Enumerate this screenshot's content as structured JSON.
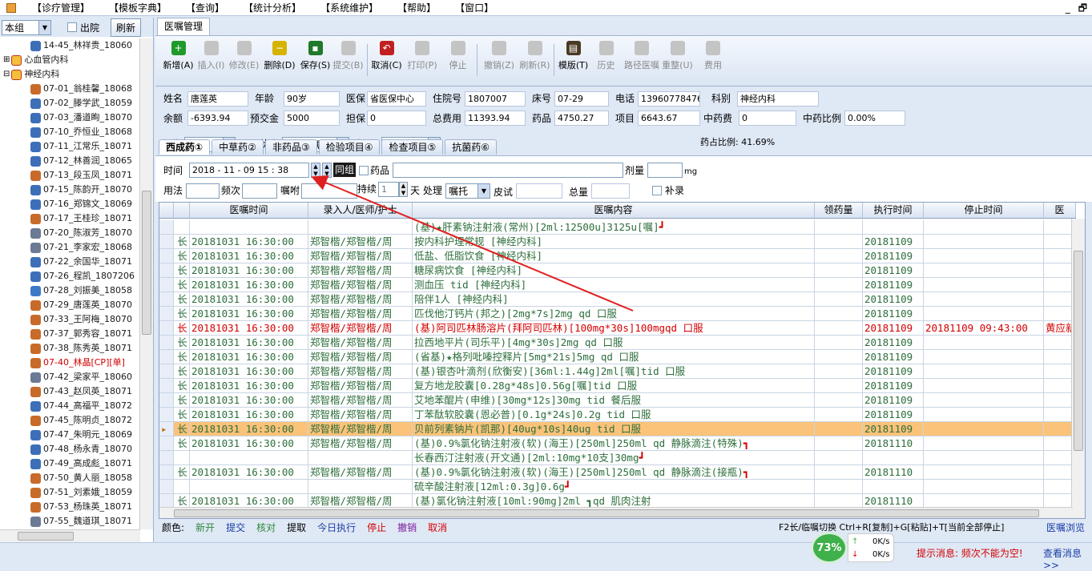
{
  "menu": [
    "【诊疗管理】",
    "【模板字典】",
    "【查询】",
    "【统计分析】",
    "【系统维护】",
    "【帮助】",
    "【窗口】"
  ],
  "window_buttons": [
    "_",
    "🗗"
  ],
  "left": {
    "group_select": "本组",
    "discharge_label": "出院",
    "refresh_label": "刷新",
    "tree": [
      {
        "label": "14-45_林祥贵_18060",
        "indent": 2,
        "icon": "person-icon",
        "color": "#1a1a1a"
      },
      {
        "label": "心血管内科",
        "indent": 0,
        "icon": "dept-icon",
        "color": "#1a1a1a",
        "expander": "+"
      },
      {
        "label": "神经内科",
        "indent": 0,
        "icon": "dept-icon",
        "color": "#1a1a1a",
        "expander": "-"
      },
      {
        "label": "07-01_翁桂馨_18068",
        "indent": 2,
        "icon": "person-f-icon",
        "color": "#1a1a1a"
      },
      {
        "label": "07-02_滕学武_18059",
        "indent": 2,
        "icon": "person-icon",
        "color": "#1a1a1a"
      },
      {
        "label": "07-03_潘道眴_18070",
        "indent": 2,
        "icon": "person-icon",
        "color": "#1a1a1a"
      },
      {
        "label": "07-10_乔恒业_18068",
        "indent": 2,
        "icon": "person-icon",
        "color": "#1a1a1a"
      },
      {
        "label": "07-11_江常乐_18071",
        "indent": 2,
        "icon": "person-icon",
        "color": "#1a1a1a"
      },
      {
        "label": "07-12_林善润_18065",
        "indent": 2,
        "icon": "person-icon",
        "color": "#1a1a1a"
      },
      {
        "label": "07-13_段玉凤_18071",
        "indent": 2,
        "icon": "person-f-icon",
        "color": "#1a1a1a"
      },
      {
        "label": "07-15_陈韵开_18070",
        "indent": 2,
        "icon": "person-icon",
        "color": "#1a1a1a"
      },
      {
        "label": "07-16_郑锦文_18069",
        "indent": 2,
        "icon": "person-icon",
        "color": "#1a1a1a"
      },
      {
        "label": "07-17_王桂珍_18071",
        "indent": 2,
        "icon": "person-f-icon",
        "color": "#1a1a1a"
      },
      {
        "label": "07-20_陈淑芳_18070",
        "indent": 2,
        "icon": "printer-icon",
        "color": "#1a1a1a"
      },
      {
        "label": "07-21_李家宏_18068",
        "indent": 2,
        "icon": "printer-icon",
        "color": "#1a1a1a"
      },
      {
        "label": "07-22_余国华_18071",
        "indent": 2,
        "icon": "person-icon",
        "color": "#1a1a1a"
      },
      {
        "label": "07-26_程凯_1807206",
        "indent": 2,
        "icon": "person-icon",
        "color": "#1a1a1a"
      },
      {
        "label": "07-28_刘振美_18058",
        "indent": 2,
        "icon": "check-icon",
        "color": "#1a1a1a"
      },
      {
        "label": "07-29_唐莲英_18070",
        "indent": 2,
        "icon": "person-f-icon",
        "color": "#1a1a1a"
      },
      {
        "label": "07-33_王阿梅_18070",
        "indent": 2,
        "icon": "person-f-icon",
        "color": "#1a1a1a"
      },
      {
        "label": "07-37_郭秀容_18071",
        "indent": 2,
        "icon": "person-f-icon",
        "color": "#1a1a1a"
      },
      {
        "label": "07-38_陈秀英_18071",
        "indent": 2,
        "icon": "person-f-icon",
        "color": "#1a1a1a"
      },
      {
        "label": "07-40_林晶[CP][单]",
        "indent": 2,
        "icon": "person-f-icon",
        "color": "#d40000"
      },
      {
        "label": "07-42_梁家平_18060",
        "indent": 2,
        "icon": "printer-icon",
        "color": "#1a1a1a"
      },
      {
        "label": "07-43_赵凤英_18071",
        "indent": 2,
        "icon": "person-f-icon",
        "color": "#1a1a1a"
      },
      {
        "label": "07-44_高福平_18072",
        "indent": 2,
        "icon": "person-icon",
        "color": "#1a1a1a"
      },
      {
        "label": "07-45_陈明贞_18072",
        "indent": 2,
        "icon": "person-f-icon",
        "color": "#1a1a1a"
      },
      {
        "label": "07-47_朱明元_18069",
        "indent": 2,
        "icon": "person-icon",
        "color": "#1a1a1a"
      },
      {
        "label": "07-48_杨永青_18070",
        "indent": 2,
        "icon": "person-icon",
        "color": "#1a1a1a"
      },
      {
        "label": "07-49_高成彪_18071",
        "indent": 2,
        "icon": "person-icon",
        "color": "#1a1a1a"
      },
      {
        "label": "07-50_黄人丽_18058",
        "indent": 2,
        "icon": "person-f-icon",
        "color": "#1a1a1a"
      },
      {
        "label": "07-51_刘素娥_18059",
        "indent": 2,
        "icon": "person-f-icon",
        "color": "#1a1a1a"
      },
      {
        "label": "07-53_杨珠英_18071",
        "indent": 2,
        "icon": "person-f-icon",
        "color": "#1a1a1a"
      },
      {
        "label": "07-55_魏道琪_18071",
        "indent": 2,
        "icon": "printer-icon",
        "color": "#1a1a1a"
      },
      {
        "label": "07-56_黄祖圣_18068",
        "indent": 2,
        "icon": "person-icon",
        "color": "#1a1a1a"
      },
      {
        "label": "07-59_王丽英_18071",
        "indent": 2,
        "icon": "person-f-icon",
        "color": "#1a1a1a"
      },
      {
        "label": "神内测试_测试专用",
        "indent": 2,
        "icon": "printer-icon",
        "color": "#1a1a1a"
      }
    ]
  },
  "main_tab": "医嘱管理",
  "toolbar": [
    {
      "label": "新增(A)",
      "icon": "add-icon",
      "enabled": true,
      "color": "#1f9a2a",
      "glyph": "+"
    },
    {
      "label": "插入(I)",
      "icon": "insert-icon",
      "enabled": false,
      "color": "#c4c4c4",
      "glyph": ""
    },
    {
      "label": "修改(E)",
      "icon": "edit-icon",
      "enabled": false,
      "color": "#c4c4c4",
      "glyph": ""
    },
    {
      "label": "删除(D)",
      "icon": "delete-icon",
      "enabled": true,
      "color": "#d4b400",
      "glyph": "−",
      "dropdown": true
    },
    {
      "label": "保存(S)",
      "icon": "save-icon",
      "enabled": true,
      "color": "#1f7a2a",
      "glyph": "▪"
    },
    {
      "label": "提交(B)",
      "icon": "submit-icon",
      "enabled": false,
      "color": "#c4c4c4",
      "glyph": ""
    },
    {
      "label": "取消(C)",
      "icon": "undo-icon",
      "enabled": true,
      "color": "#c02020",
      "glyph": "↶"
    },
    {
      "label": "打印(P)",
      "icon": "print-icon",
      "enabled": false,
      "color": "#c4c4c4",
      "glyph": "",
      "dropdown": true
    },
    {
      "label": "停止",
      "icon": "stop-icon",
      "enabled": false,
      "color": "#c4c4c4",
      "glyph": ""
    },
    {
      "label": "撤销(Z)",
      "icon": "trash-icon",
      "enabled": false,
      "color": "#c4c4c4",
      "glyph": "",
      "dropdown": true
    },
    {
      "label": "刷新(R)",
      "icon": "refresh-icon",
      "enabled": false,
      "color": "#c4c4c4",
      "glyph": ""
    },
    {
      "label": "模版(T)",
      "icon": "template-icon",
      "enabled": true,
      "color": "#4a3a24",
      "glyph": "▤"
    },
    {
      "label": "历史",
      "icon": "history-icon",
      "enabled": false,
      "color": "#c4c4c4",
      "glyph": ""
    },
    {
      "label": "路径医嘱",
      "icon": "path-icon",
      "enabled": false,
      "color": "#c4c4c4",
      "glyph": "",
      "dropdown": true
    },
    {
      "label": "重整(U)",
      "icon": "reorganize-icon",
      "enabled": false,
      "color": "#c4c4c4",
      "glyph": ""
    },
    {
      "label": "费用",
      "icon": "fee-icon",
      "enabled": false,
      "color": "#c4c4c4",
      "glyph": "",
      "dropdown": true
    }
  ],
  "patient": {
    "name_label": "姓名",
    "name": "唐莲英",
    "age_label": "年龄",
    "age": "90岁",
    "insurance_label": "医保",
    "insurance": "省医保中心",
    "admission_label": "住院号",
    "admission": "1807007",
    "bed_label": "床号",
    "bed": "07-29",
    "phone_label": "电话",
    "phone": "13960778476",
    "dept_label": "科别",
    "dept": "神经内科",
    "balance_label": "余额",
    "balance": "-6393.94",
    "deposit_label": "预交金",
    "deposit": "5000",
    "guarantee_label": "担保",
    "guarantee": "0",
    "total_label": "总费用",
    "total": "11393.94",
    "drug_label": "药品",
    "drug": "4750.27",
    "item_label": "项目",
    "item": "6643.67",
    "herb_label": "中药费",
    "herb": "0",
    "herb_ratio_label": "中药比例",
    "herb_ratio": "0.00%"
  },
  "filters": {
    "longterm_label": "长临",
    "longterm": "长嘱",
    "status_label": "医嘱状态",
    "status": "今日医嘱",
    "category_label": "类别",
    "category": "全部",
    "drug_ratio": "药占比例: 41.69%"
  },
  "subtabs": [
    "西成药①",
    "中草药②",
    "非药品③",
    "检验项目④",
    "检查项目⑤",
    "抗菌药⑥"
  ],
  "form": {
    "time_label": "时间",
    "time": "2018 - 11 - 09   15 : 38",
    "group_label": "同组",
    "drug_label": "药品",
    "dose_label": "剂量",
    "dose_unit": "mg",
    "usage_label": "用法",
    "freq_label": "频次",
    "note_label": "嘱咐",
    "duration_label": "持续",
    "duration": "1",
    "day_label": "天",
    "process_label": "处理",
    "process": "嘱托",
    "skin_label": "皮试",
    "total_label": "总量",
    "supplement_label": "补录"
  },
  "grid": {
    "headers": [
      "",
      "",
      "医嘱时间",
      "录入人/医师/护士",
      "医嘱内容",
      "领药量",
      "执行时间",
      "停止时间",
      "医"
    ],
    "rows": [
      {
        "type": "",
        "time": "",
        "user": "",
        "content": "(基)★肝素钠注射液(常州)[2ml:12500u]3125u[嘱]",
        "exec": "",
        "stop": "",
        "extra": "",
        "style": "normal",
        "bracket": "┛"
      },
      {
        "type": "长",
        "time": "20181031 16:30:00",
        "user": "郑智楷/郑智楷/周",
        "content": "按内科护理常规   [神经内科]",
        "exec": "20181109",
        "stop": "",
        "extra": "",
        "style": "normal"
      },
      {
        "type": "长",
        "time": "20181031 16:30:00",
        "user": "郑智楷/郑智楷/周",
        "content": "低盐、低脂饮食   [神经内科]",
        "exec": "20181109",
        "stop": "",
        "extra": "",
        "style": "normal"
      },
      {
        "type": "长",
        "time": "20181031 16:30:00",
        "user": "郑智楷/郑智楷/周",
        "content": "糖尿病饮食    [神经内科]",
        "exec": "20181109",
        "stop": "",
        "extra": "",
        "style": "normal"
      },
      {
        "type": "长",
        "time": "20181031 16:30:00",
        "user": "郑智楷/郑智楷/周",
        "content": "测血压 tid  [神经内科]",
        "exec": "20181109",
        "stop": "",
        "extra": "",
        "style": "normal"
      },
      {
        "type": "长",
        "time": "20181031 16:30:00",
        "user": "郑智楷/郑智楷/周",
        "content": "陪伴1人    [神经内科]",
        "exec": "20181109",
        "stop": "",
        "extra": "",
        "style": "normal"
      },
      {
        "type": "长",
        "time": "20181031 16:30:00",
        "user": "郑智楷/郑智楷/周",
        "content": "匹伐他汀钙片(邦之)[2mg*7s]2mg qd 口服",
        "exec": "20181109",
        "stop": "",
        "extra": "",
        "style": "normal"
      },
      {
        "type": "长",
        "time": "20181031 16:30:00",
        "user": "郑智楷/郑智楷/周",
        "content": "(基)阿司匹林肠溶片(拜阿司匹林)[100mg*30s]100mgqd 口服",
        "exec": "20181109",
        "stop": "20181109 09:43:00",
        "extra": "黄应新",
        "style": "red"
      },
      {
        "type": "长",
        "time": "20181031 16:30:00",
        "user": "郑智楷/郑智楷/周",
        "content": "拉西地平片(司乐平)[4mg*30s]2mg qd 口服",
        "exec": "20181109",
        "stop": "",
        "extra": "",
        "style": "normal"
      },
      {
        "type": "长",
        "time": "20181031 16:30:00",
        "user": "郑智楷/郑智楷/周",
        "content": "(省基)★格列吡嗪控释片[5mg*21s]5mg qd 口服",
        "exec": "20181109",
        "stop": "",
        "extra": "",
        "style": "normal"
      },
      {
        "type": "长",
        "time": "20181031 16:30:00",
        "user": "郑智楷/郑智楷/周",
        "content": "(基)银杏叶滴剂(欣衡安)[36ml:1.44g]2ml[嘱]tid 口服",
        "exec": "20181109",
        "stop": "",
        "extra": "",
        "style": "normal"
      },
      {
        "type": "长",
        "time": "20181031 16:30:00",
        "user": "郑智楷/郑智楷/周",
        "content": "复方地龙胶囊[0.28g*48s]0.56g[嘱]tid 口服",
        "exec": "20181109",
        "stop": "",
        "extra": "",
        "style": "normal"
      },
      {
        "type": "长",
        "time": "20181031 16:30:00",
        "user": "郑智楷/郑智楷/周",
        "content": "艾地苯醌片(申维)[30mg*12s]30mg tid 餐后服",
        "exec": "20181109",
        "stop": "",
        "extra": "",
        "style": "normal"
      },
      {
        "type": "长",
        "time": "20181031 16:30:00",
        "user": "郑智楷/郑智楷/周",
        "content": "丁苯酞软胶囊(恩必普)[0.1g*24s]0.2g tid 口服",
        "exec": "20181109",
        "stop": "",
        "extra": "",
        "style": "normal"
      },
      {
        "type": "长",
        "time": "20181031 16:30:00",
        "user": "郑智楷/郑智楷/周",
        "content": "贝前列素钠片(凯那)[40ug*10s]40ug tid 口服",
        "exec": "20181109",
        "stop": "",
        "extra": "",
        "style": "sel"
      },
      {
        "type": "长",
        "time": "20181031 16:30:00",
        "user": "郑智楷/郑智楷/周",
        "content": "(基)0.9%氯化钠注射液(软)(海王)[250ml]250ml qd 静脉滴注(特殊)",
        "exec": "20181110",
        "stop": "",
        "extra": "",
        "style": "normal",
        "bracket": "┓"
      },
      {
        "type": "",
        "time": "",
        "user": "",
        "content": "长春西汀注射液(开文通)[2ml:10mg*10支]30mg",
        "exec": "",
        "stop": "",
        "extra": "",
        "style": "normal",
        "bracket": "┛"
      },
      {
        "type": "长",
        "time": "20181031 16:30:00",
        "user": "郑智楷/郑智楷/周",
        "content": "(基)0.9%氯化钠注射液(软)(海王)[250ml]250ml qd 静脉滴注(接瓶)",
        "exec": "20181110",
        "stop": "",
        "extra": "",
        "style": "normal",
        "bracket": "┓"
      },
      {
        "type": "",
        "time": "",
        "user": "",
        "content": "硫辛酸注射液[12ml:0.3g]0.6g",
        "exec": "",
        "stop": "",
        "extra": "",
        "style": "normal",
        "bracket": "┛"
      },
      {
        "type": "长",
        "time": "20181031 16:30:00",
        "user": "郑智楷/郑智楷/周",
        "content": "(基)氯化钠注射液[10ml:90mg]2ml           ┓qd 肌肉注射",
        "exec": "20181110",
        "stop": "",
        "extra": "",
        "style": "normal"
      }
    ]
  },
  "legend": [
    {
      "label": "颜色:",
      "color": "#000000"
    },
    {
      "label": "新开",
      "color": "#2d8a3c"
    },
    {
      "label": "提交",
      "color": "#1a3ea8"
    },
    {
      "label": "核对",
      "color": "#2d8a3c"
    },
    {
      "label": "提取",
      "color": "#000000"
    },
    {
      "label": "今日执行",
      "color": "#1a3ea8"
    },
    {
      "label": "停止",
      "color": "#d40000"
    },
    {
      "label": "撤销",
      "color": "#7a1a9a"
    },
    {
      "label": "取消",
      "color": "#d40000"
    }
  ],
  "hint_text": "F2长/临嘱切换 Ctrl+R[复制]+G[粘贴]+T[当前全部停止]",
  "browse_link": "医嘱浏览",
  "status": {
    "gauge": "73%",
    "up_speed": "0K/s",
    "down_speed": "0K/s",
    "message": "提示消息: 频次不能为空!",
    "view_messages": "查看消息>>"
  }
}
